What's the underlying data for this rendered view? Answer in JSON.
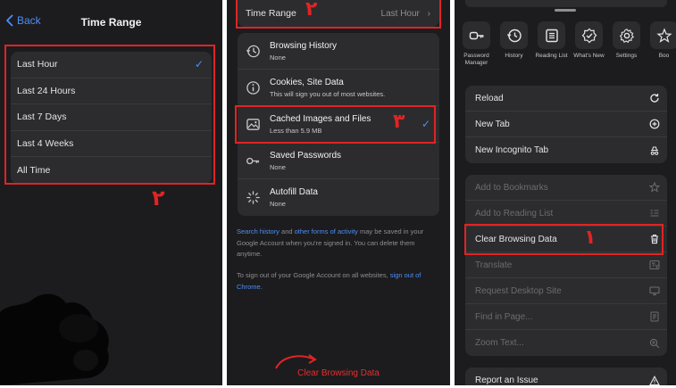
{
  "panel1": {
    "back_label": "Back",
    "title": "Time Range",
    "options": [
      "Last Hour",
      "Last 24 Hours",
      "Last 7 Days",
      "Last 4 Weeks",
      "All Time"
    ],
    "check_glyph": "✓",
    "annotation": "٢"
  },
  "panel2": {
    "time_range_label": "Time Range",
    "time_range_value": "Last Hour",
    "time_range_annotation": "٢",
    "items": [
      {
        "title": "Browsing History",
        "subtitle": "None",
        "icon": "history-icon"
      },
      {
        "title": "Cookies, Site Data",
        "subtitle": "This will sign you out of most websites.",
        "icon": "info-icon"
      },
      {
        "title": "Cached Images and Files",
        "subtitle": "Less than 5.9 MB",
        "icon": "image-icon"
      },
      {
        "title": "Saved Passwords",
        "subtitle": "None",
        "icon": "key-icon"
      },
      {
        "title": "Autofill Data",
        "subtitle": "None",
        "icon": "sparkle-icon"
      }
    ],
    "cached_annotation": "٣",
    "check_glyph": "✓",
    "info1": {
      "link1": "Search history",
      "text1": " and ",
      "link2": "other forms of activity",
      "text2": " may be saved in your Google Account when you're signed in. You can delete them anytime."
    },
    "info2": {
      "text1": "To sign out of your Google Account on all websites, ",
      "link1": "sign out of Chrome",
      "text2": "."
    },
    "clear_button": "Clear Browsing Data"
  },
  "panel3": {
    "tiles": [
      {
        "label": "Password Manager",
        "icon": "key-icon"
      },
      {
        "label": "History",
        "icon": "history-icon"
      },
      {
        "label": "Reading List",
        "icon": "reading-list-icon"
      },
      {
        "label": "What's New",
        "icon": "badge-check-icon"
      },
      {
        "label": "Settings",
        "icon": "gear-icon"
      },
      {
        "label": "Boo",
        "icon": "star-icon"
      }
    ],
    "menu1": [
      {
        "label": "Reload",
        "icon": "reload-icon"
      },
      {
        "label": "New Tab",
        "icon": "plus-circle-icon"
      },
      {
        "label": "New Incognito Tab",
        "icon": "incognito-icon"
      }
    ],
    "menu2": [
      {
        "label": "Add to Bookmarks",
        "icon": "star-icon",
        "dim": true
      },
      {
        "label": "Add to Reading List",
        "icon": "reading-list-icon",
        "dim": true
      },
      {
        "label": "Clear Browsing Data",
        "icon": "trash-icon",
        "dim": false
      },
      {
        "label": "Translate",
        "icon": "translate-icon",
        "dim": true
      },
      {
        "label": "Request Desktop Site",
        "icon": "desktop-icon",
        "dim": true
      },
      {
        "label": "Find in Page...",
        "icon": "find-icon",
        "dim": true
      },
      {
        "label": "Zoom Text...",
        "icon": "zoom-icon",
        "dim": true
      }
    ],
    "clear_annotation": "١",
    "menu3": [
      {
        "label": "Report an Issue",
        "icon": "warning-icon"
      }
    ]
  },
  "colors": {
    "background": "#1c1c1e",
    "card": "#2c2c2e",
    "accent": "#4d8ef7",
    "annotation_red": "#e02424"
  }
}
